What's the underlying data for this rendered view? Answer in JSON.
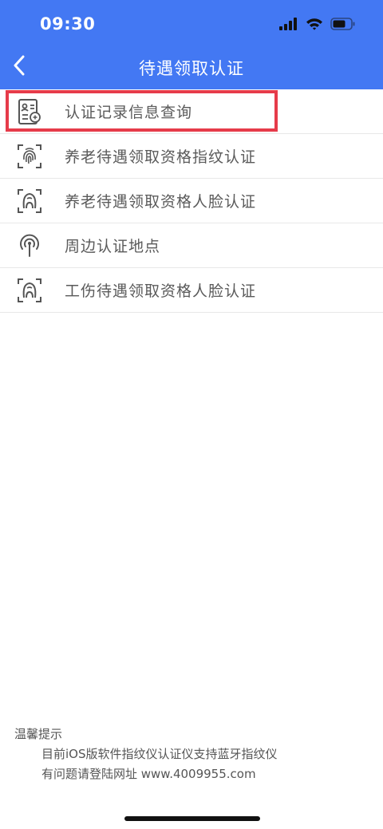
{
  "status_bar": {
    "time": "09:30"
  },
  "nav": {
    "title": "待遇领取认证",
    "back_icon": "chevron-left-icon"
  },
  "colors": {
    "primary": "#4378f3",
    "highlight": "#e63b4a",
    "text": "#5a5a5a"
  },
  "menu": {
    "items": [
      {
        "label": "认证记录信息查询",
        "icon": "record-search-icon",
        "highlighted": true
      },
      {
        "label": "养老待遇领取资格指纹认证",
        "icon": "fingerprint-icon"
      },
      {
        "label": "养老待遇领取资格人脸认证",
        "icon": "face-scan-icon"
      },
      {
        "label": "周边认证地点",
        "icon": "location-signal-icon"
      },
      {
        "label": "工伤待遇领取资格人脸认证",
        "icon": "face-scan-icon"
      }
    ]
  },
  "tips": {
    "title": "温馨提示",
    "lines": [
      "目前iOS版软件指纹仪认证仪支持蓝牙指纹仪",
      "有问题请登陆网址 www.4009955.com"
    ]
  }
}
